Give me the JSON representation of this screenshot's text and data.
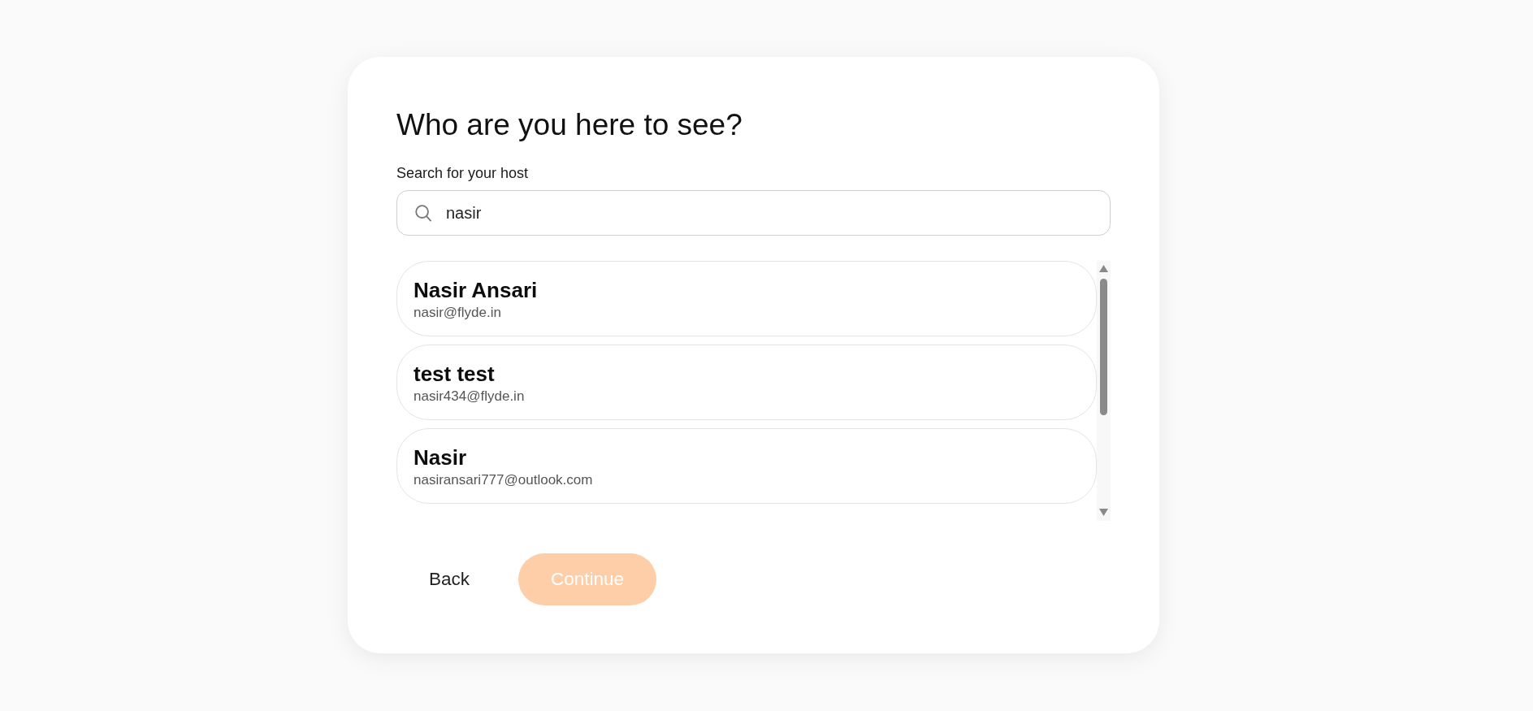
{
  "heading": "Who are you here to see?",
  "search": {
    "label": "Search for your host",
    "value": "nasir"
  },
  "hosts": [
    {
      "name": "Nasir Ansari",
      "email": "nasir@flyde.in"
    },
    {
      "name": "test test",
      "email": "nasir434@flyde.in"
    },
    {
      "name": "Nasir",
      "email": "nasiransari777@outlook.com"
    }
  ],
  "buttons": [
    {
      "label": "Back",
      "kind": "text",
      "disabled": false
    },
    {
      "label": "Continue",
      "kind": "primary",
      "disabled": true
    }
  ]
}
